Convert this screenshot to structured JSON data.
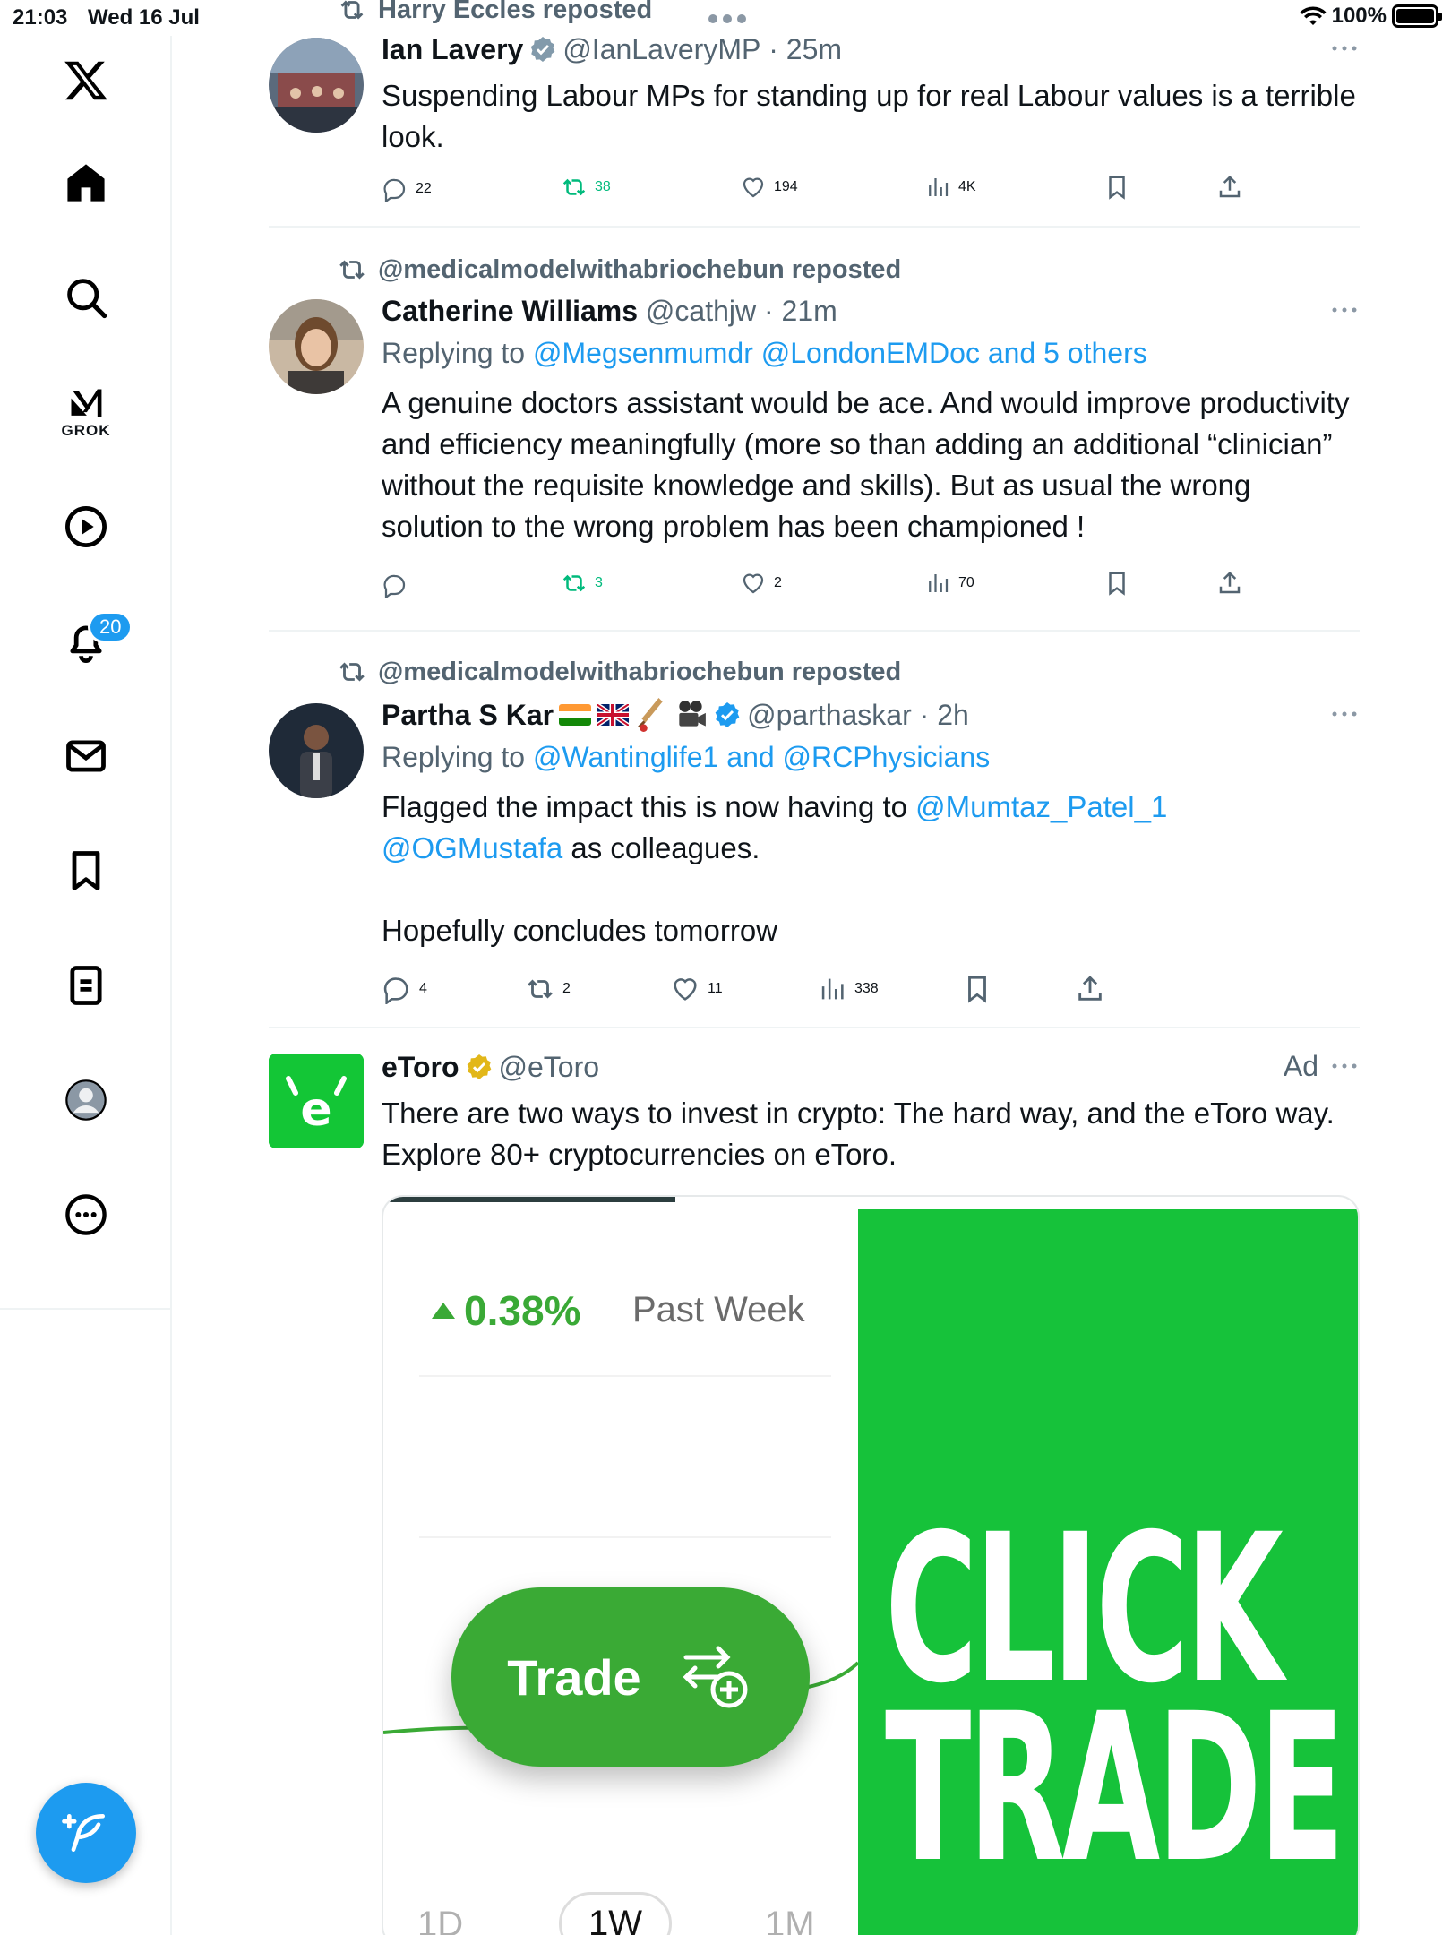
{
  "status_bar": {
    "time": "21:03",
    "date": "Wed 16 Jul",
    "battery": "100%"
  },
  "sidebar": {
    "items": [
      {
        "name": "x-logo",
        "label": ""
      },
      {
        "name": "home",
        "label": ""
      },
      {
        "name": "search",
        "label": ""
      },
      {
        "name": "grok",
        "label": "GROK"
      },
      {
        "name": "video",
        "label": ""
      },
      {
        "name": "notifications",
        "label": ""
      },
      {
        "name": "messages",
        "label": ""
      },
      {
        "name": "bookmarks",
        "label": ""
      },
      {
        "name": "lists",
        "label": ""
      },
      {
        "name": "profile",
        "label": ""
      },
      {
        "name": "more",
        "label": ""
      }
    ],
    "notifications_badge": "20",
    "compose_icon": "feather-plus-icon"
  },
  "tweets": [
    {
      "repost_by": "Harry Eccles reposted",
      "name": "Ian Lavery",
      "handle": "@IanLaveryMP",
      "time": "25m",
      "verified": "grey",
      "text": "Suspending Labour MPs for standing up for real Labour values is a terrible look.",
      "replies": "22",
      "reposts": "38",
      "likes": "194",
      "views": "4K"
    },
    {
      "repost_by": "@medicalmodelwithabriochebun reposted",
      "name": "Catherine Williams",
      "handle": "@cathjw",
      "time": "21m",
      "reply_prefix": "Replying to",
      "reply_targets": "@Megsenmumdr @LondonEMDoc and 5 others",
      "text": "A genuine doctors assistant would be ace. And would improve productivity and efficiency meaningfully (more so than adding an additional “clinician” without the requisite knowledge and skills). But as usual the wrong solution to the wrong problem has been championed !",
      "replies": "",
      "reposts": "3",
      "likes": "2",
      "views": "70"
    },
    {
      "repost_by": "@medicalmodelwithabriochebun reposted",
      "name": "Partha S Kar",
      "handle": "@parthaskar",
      "time": "2h",
      "verified": "blue",
      "reply_prefix": "Replying to",
      "reply_targets": "@Wantinglife1 and @RCPhysicians",
      "text_before": "Flagged the impact this is now having to ",
      "mention1": "@Mumtaz_Patel_1",
      "mention2": "@OGMustafa",
      "text_after": " as colleagues.",
      "text_para2": "Hopefully concludes tomorrow",
      "replies": "4",
      "reposts": "2",
      "likes": "11",
      "views": "338"
    },
    {
      "name": "eToro",
      "handle": "@eToro",
      "verified": "gold",
      "ad_label": "Ad",
      "text": "There are two ways to invest in crypto: The hard way, and the eToro way. Explore 80+ cryptocurrencies on eToro.",
      "media": {
        "change": "0.38%",
        "period_label": "Past Week",
        "button": "Trade",
        "headline_1": "CLICK",
        "headline_2": "TRADE",
        "periods": [
          "1D",
          "1W",
          "1M"
        ]
      }
    }
  ],
  "colors": {
    "accent": "#1d9bf0",
    "repost_green": "#00ba7c",
    "etoro_green": "#16c23a"
  }
}
